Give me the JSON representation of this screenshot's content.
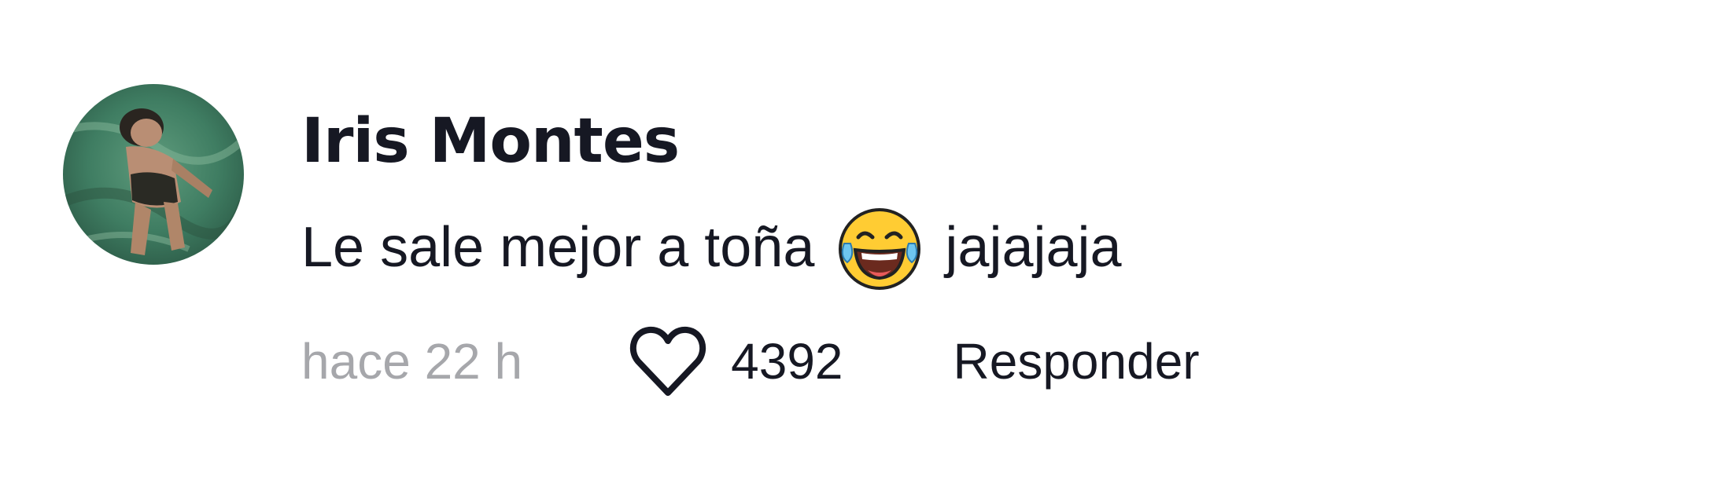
{
  "comment": {
    "username": "Iris Montes",
    "text_before_emoji": "Le sale mejor a toña",
    "emoji_icon": "face-with-tears-of-joy-icon",
    "text_after_emoji": "jajajaja",
    "timestamp": "hace 22 h",
    "like_icon": "heart-outline-icon",
    "like_count": "4392",
    "reply_label": "Responder"
  },
  "colors": {
    "primary_text": "#161823",
    "secondary_text": "#A6A7AB",
    "background": "#FFFFFF"
  }
}
